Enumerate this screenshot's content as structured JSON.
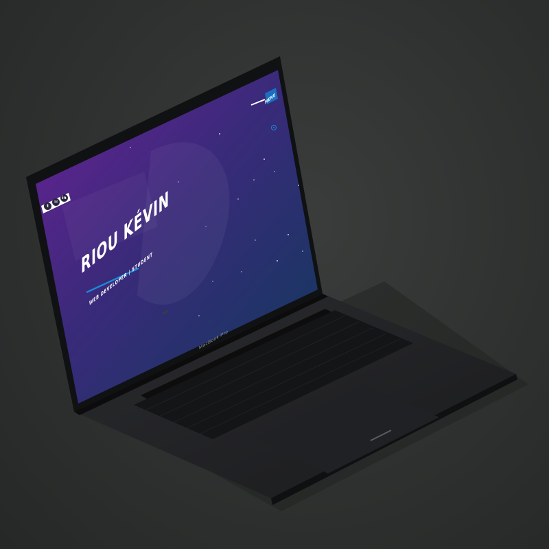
{
  "website": {
    "title": "RIOU KÉVIN",
    "subtitle": "WEB DEVELOPER | STUDENT",
    "menu_label": "MENU",
    "social_links": [
      {
        "icon": "twitter-icon",
        "glyph": "t"
      },
      {
        "icon": "mail-icon",
        "glyph": "✉"
      },
      {
        "icon": "linkedin-icon",
        "glyph": "in"
      }
    ]
  },
  "device": {
    "model_label": "MacBook Pro"
  },
  "colors": {
    "background": "#2f3130",
    "gradient_start": "#5a1f86",
    "gradient_end": "#0f3a5c",
    "accent": "#1a8ad8",
    "laptop_body": "#1c1d1f"
  }
}
